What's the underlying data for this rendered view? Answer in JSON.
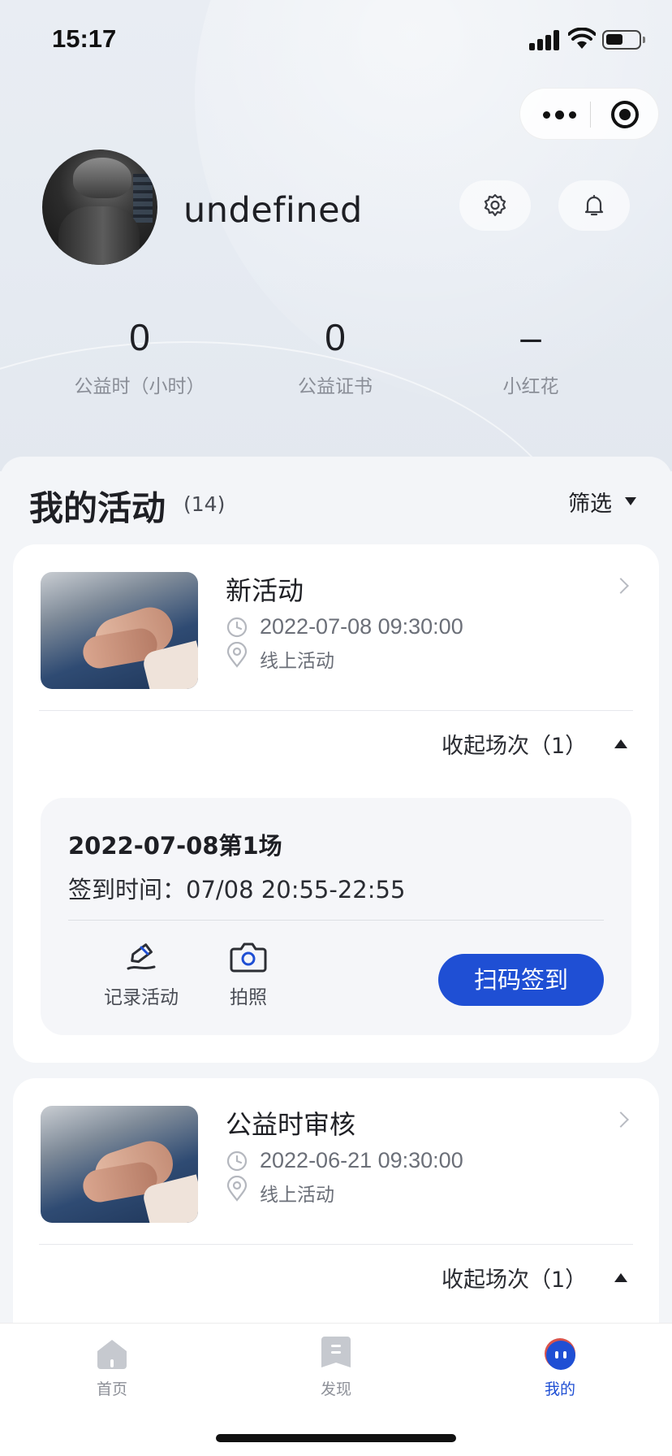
{
  "status_bar": {
    "time": "15:17"
  },
  "profile": {
    "username": "undefined"
  },
  "stats": [
    {
      "value": "0",
      "label": "公益时（小时）"
    },
    {
      "value": "0",
      "label": "公益证书"
    },
    {
      "value": "–",
      "label": "小红花"
    }
  ],
  "section": {
    "title": "我的活动",
    "count": "(14)",
    "filter_label": "筛选"
  },
  "activities": [
    {
      "title": "新活动",
      "datetime": "2022-07-08 09:30:00",
      "location": "线上活动",
      "collapse_label": "收起场次（1）",
      "session": {
        "title": "2022-07-08第1场",
        "checkin_time": "签到时间：07/08 20:55-22:55",
        "record_label": "记录活动",
        "photo_label": "拍照",
        "scan_label": "扫码签到"
      }
    },
    {
      "title": "公益时审核",
      "datetime": "2022-06-21 09:30:00",
      "location": "线上活动",
      "collapse_label": "收起场次（1）"
    }
  ],
  "tabbar": [
    {
      "label": "首页",
      "icon": "home-icon"
    },
    {
      "label": "发现",
      "icon": "discover-icon"
    },
    {
      "label": "我的",
      "icon": "mine-icon"
    }
  ],
  "colors": {
    "primary": "#1f4fd4",
    "background": "#f3f5f8",
    "text": "#1e1f24"
  }
}
